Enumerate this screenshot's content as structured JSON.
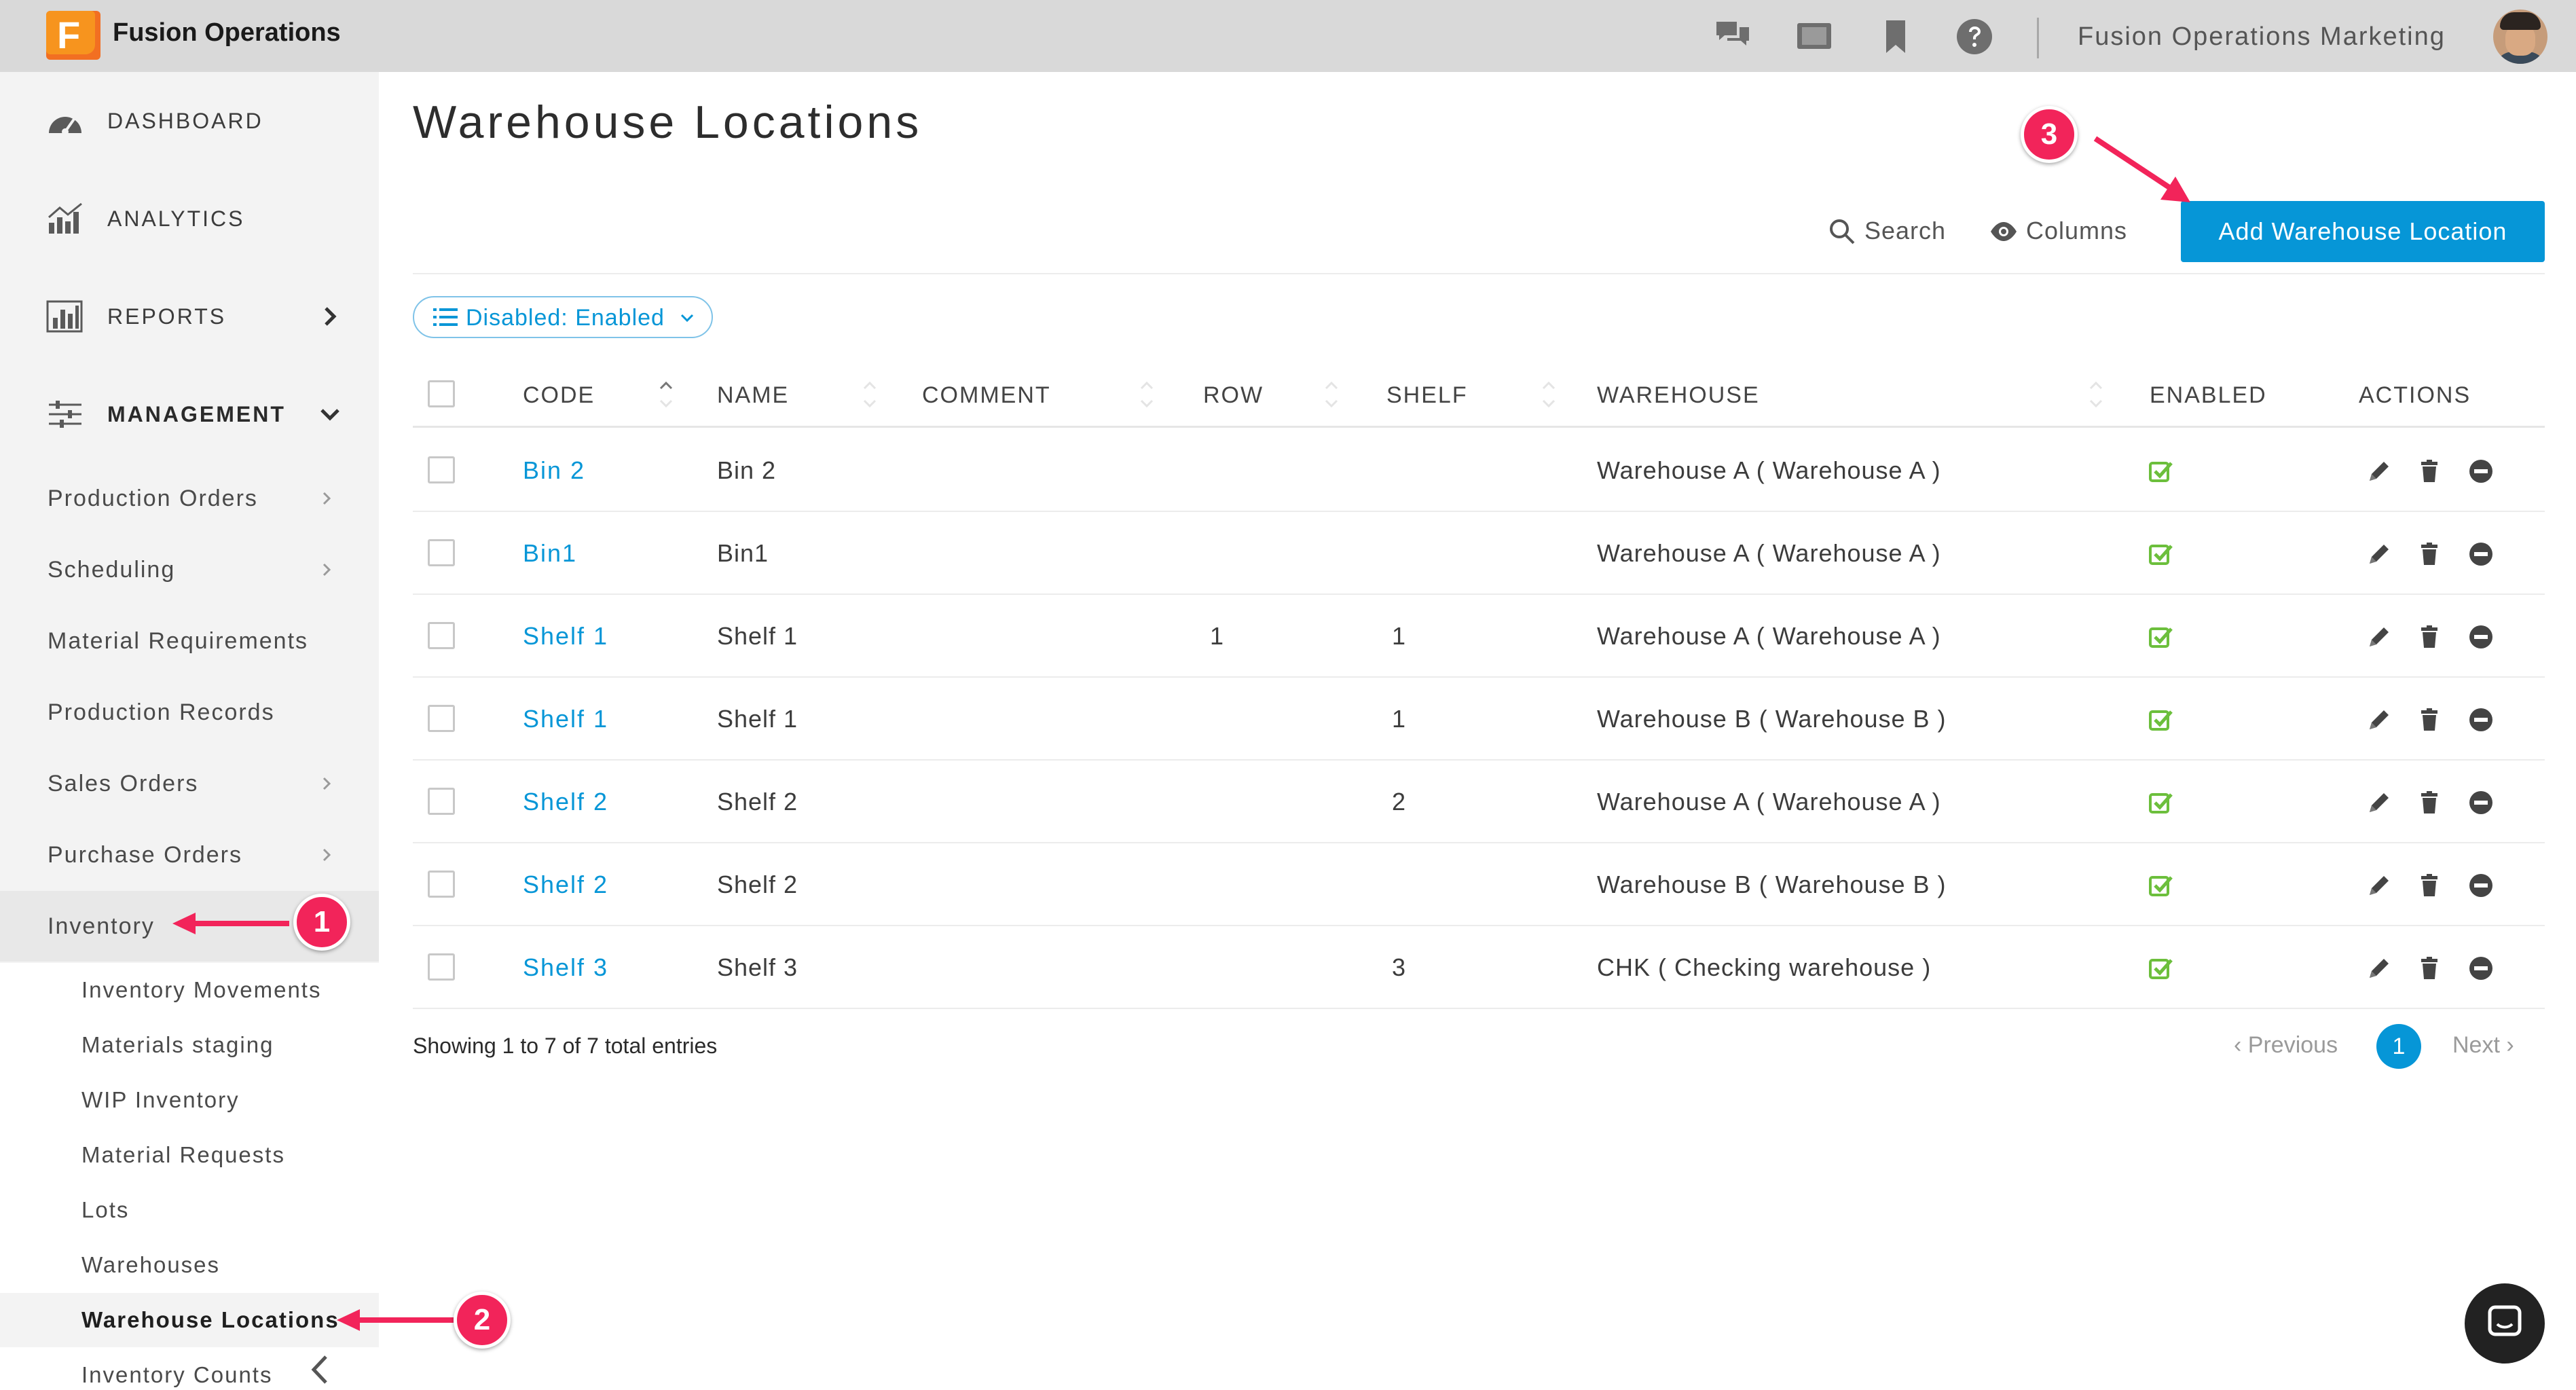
{
  "app": {
    "logo_letter": "F",
    "name": "Fusion Operations",
    "org_name": "Fusion Operations Marketing"
  },
  "topbar_icons": [
    "chat-icon",
    "screen-icon",
    "bookmark-icon",
    "help-icon"
  ],
  "sidebar": {
    "main": [
      {
        "label": "DASHBOARD",
        "icon": "dashboard-gauge-icon"
      },
      {
        "label": "ANALYTICS",
        "icon": "analytics-chart-icon"
      },
      {
        "label": "REPORTS",
        "icon": "reports-chart-icon",
        "chevron": "right"
      },
      {
        "label": "MANAGEMENT",
        "icon": "sliders-icon",
        "chevron": "down"
      }
    ],
    "management": [
      {
        "label": "Production Orders",
        "chevron": true
      },
      {
        "label": "Scheduling",
        "chevron": true
      },
      {
        "label": "Material Requirements",
        "chevron": false
      },
      {
        "label": "Production Records",
        "chevron": false
      },
      {
        "label": "Sales Orders",
        "chevron": true
      },
      {
        "label": "Purchase Orders",
        "chevron": true
      },
      {
        "label": "Inventory",
        "chevron": false
      }
    ],
    "inventory": [
      "Inventory Movements",
      "Materials staging",
      "WIP Inventory",
      "Material Requests",
      "Lots",
      "Warehouses",
      "Warehouse Locations",
      "Inventory Counts"
    ],
    "active_item": "Warehouse Locations"
  },
  "page": {
    "title": "Warehouse Locations",
    "search_label": "Search",
    "columns_label": "Columns",
    "add_button": "Add Warehouse Location",
    "filter_label": "Disabled: Enabled"
  },
  "table": {
    "columns": [
      "CODE",
      "NAME",
      "COMMENT",
      "ROW",
      "SHELF",
      "WAREHOUSE",
      "ENABLED",
      "ACTIONS"
    ],
    "rows": [
      {
        "code": "Bin 2",
        "name": "Bin 2",
        "comment": "",
        "row": "",
        "shelf": "",
        "warehouse": "Warehouse A ( Warehouse A )",
        "enabled": true
      },
      {
        "code": "Bin1",
        "name": "Bin1",
        "comment": "",
        "row": "",
        "shelf": "",
        "warehouse": "Warehouse A ( Warehouse A )",
        "enabled": true
      },
      {
        "code": "Shelf 1",
        "name": "Shelf 1",
        "comment": "",
        "row": "1",
        "shelf": "1",
        "warehouse": "Warehouse A ( Warehouse A )",
        "enabled": true
      },
      {
        "code": "Shelf 1",
        "name": "Shelf 1",
        "comment": "",
        "row": "",
        "shelf": "1",
        "warehouse": "Warehouse B ( Warehouse B )",
        "enabled": true
      },
      {
        "code": "Shelf 2",
        "name": "Shelf 2",
        "comment": "",
        "row": "",
        "shelf": "2",
        "warehouse": "Warehouse A ( Warehouse A )",
        "enabled": true
      },
      {
        "code": "Shelf 2",
        "name": "Shelf 2",
        "comment": "",
        "row": "",
        "shelf": "",
        "warehouse": "Warehouse B ( Warehouse B )",
        "enabled": true
      },
      {
        "code": "Shelf 3",
        "name": "Shelf 3",
        "comment": "",
        "row": "",
        "shelf": "3",
        "warehouse": "CHK ( Checking warehouse )",
        "enabled": true
      }
    ],
    "row_actions": [
      "edit-pencil-icon",
      "delete-trash-icon",
      "disable-minus-icon"
    ]
  },
  "pagination": {
    "info": "Showing 1 to 7 of 7 total entries",
    "previous": "Previous",
    "current_page": "1",
    "next": "Next"
  },
  "callouts": [
    "1",
    "2",
    "3"
  ],
  "colors": {
    "accent": "#0696d7",
    "brand_orange": "#f7941e",
    "callout": "#f2245a",
    "enabled_check": "#6cbf3c",
    "topbar": "#d9d9d9",
    "sidebar": "#f3f3f3"
  }
}
